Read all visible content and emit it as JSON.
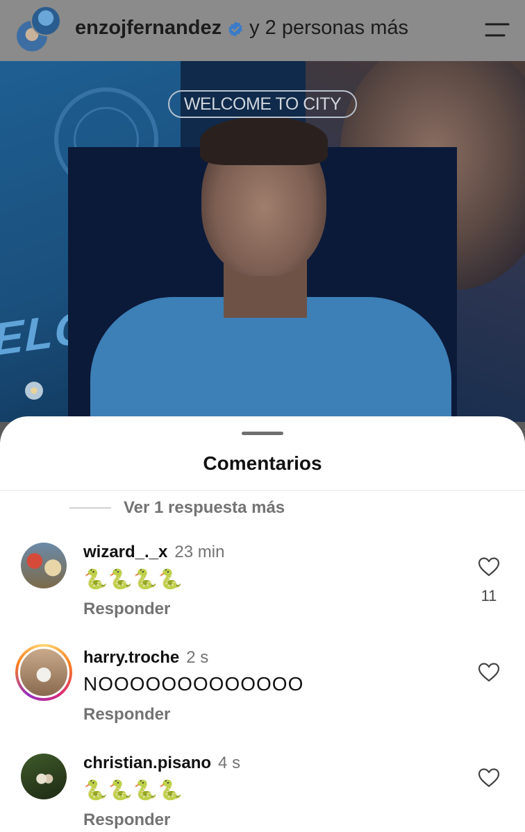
{
  "header": {
    "username": "enzojfernandez",
    "suffix": "y 2 personas más",
    "icons": {
      "verified": "verified-badge-icon",
      "menu": "menu-icon"
    },
    "accent": "#3897f0"
  },
  "post": {
    "banner_text": "WELCOME TO CITY",
    "side_text": "ELCO"
  },
  "sheet": {
    "title": "Comentarios",
    "more_replies": "Ver 1 respuesta más"
  },
  "comments": [
    {
      "username": "wizard_._x",
      "time": "23 min",
      "text": "🐍🐍🐍🐍",
      "reply": "Responder",
      "likes": "11"
    },
    {
      "username": "harry.troche",
      "time": "2 s",
      "text": "NOOOOOOOOOOOOO",
      "reply": "Responder",
      "likes": ""
    },
    {
      "username": "christian.pisano",
      "time": "4 s",
      "text": "🐍🐍🐍🐍",
      "reply": "Responder",
      "likes": ""
    }
  ]
}
